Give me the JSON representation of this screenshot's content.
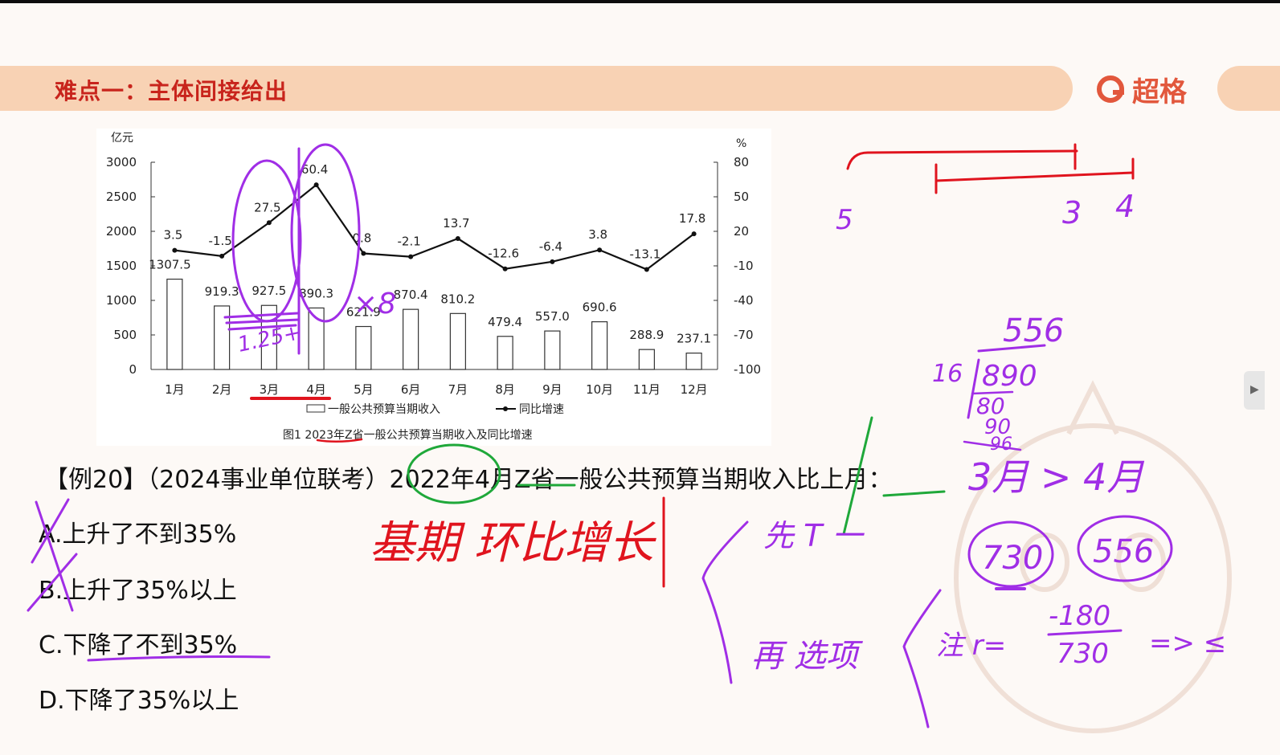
{
  "header": {
    "title": "难点一：主体间接给出",
    "brand": "超格",
    "colors": {
      "band": "#f8d2b4",
      "title": "#c8241c",
      "brand": "#e2573c"
    }
  },
  "chart_data": {
    "type": "bar",
    "left_unit": "亿元",
    "right_unit": "%",
    "categories": [
      "1月",
      "2月",
      "3月",
      "4月",
      "5月",
      "6月",
      "7月",
      "8月",
      "9月",
      "10月",
      "11月",
      "12月"
    ],
    "series": [
      {
        "name": "一般公共预算当期收入",
        "kind": "bar",
        "axis": "left",
        "values": [
          1307.5,
          919.3,
          927.5,
          890.3,
          621.9,
          870.4,
          810.2,
          479.4,
          557.0,
          690.6,
          288.9,
          237.1
        ],
        "labels": [
          "1307.5",
          "919.3",
          "927.5",
          "890.3",
          "621.9",
          "870.4",
          "810.2",
          "479.4",
          "557.0",
          "690.6",
          "288.9",
          "237.1"
        ]
      },
      {
        "name": "同比增速",
        "kind": "line",
        "axis": "right",
        "values": [
          3.5,
          -1.5,
          27.5,
          60.4,
          0.8,
          -2.1,
          13.7,
          -12.6,
          -6.4,
          3.8,
          -13.1,
          17.8
        ],
        "labels": [
          "3.5",
          "-1.5",
          "27.5",
          "60.4",
          "0.8",
          "-2.1",
          "13.7",
          "-12.6",
          "-6.4",
          "3.8",
          "-13.1",
          "17.8"
        ]
      }
    ],
    "left_axis": {
      "ylim": [
        0,
        3000
      ],
      "ticks": [
        "0",
        "500",
        "1000",
        "1500",
        "2000",
        "2500",
        "3000"
      ]
    },
    "right_axis": {
      "ylim": [
        -100,
        80
      ],
      "ticks": [
        "-100",
        "-70",
        "-40",
        "-10",
        "20",
        "50",
        "80"
      ]
    },
    "caption": "图1  2023年Z省一般公共预算当期收入及同比增速",
    "legend_position": "bottom",
    "grid": false,
    "colors": {
      "bar": "#ffffff",
      "bar_stroke": "#333333",
      "line": "#111111"
    }
  },
  "question": {
    "text": "【例20】（2024事业单位联考）2022年4月Z省一般公共预算当期收入比上月：",
    "options": [
      {
        "key": "A",
        "text": "A.上升了不到35%"
      },
      {
        "key": "B",
        "text": "B.上升了35%以上"
      },
      {
        "key": "C",
        "text": "C.下降了不到35%"
      },
      {
        "key": "D",
        "text": "D.下降了35%以上"
      }
    ]
  },
  "handwriting": {
    "chart_notes": [
      "×8",
      "1.25+"
    ],
    "timeline_labels": [
      "5",
      "3",
      "4"
    ],
    "center_note": "基期 环比增长",
    "steps": [
      "先 T 一",
      "再 选项"
    ],
    "division": {
      "quotient": "556",
      "divisor": "16",
      "dividend": "890",
      "step1": "80",
      "step2": "90",
      "step3": "96"
    },
    "compare": "3月 > 4月",
    "circled": [
      "730",
      "556"
    ],
    "formula_prefix": "注 r=",
    "numerator": "-180",
    "denominator": "730",
    "result": "=> ≤",
    "colors": {
      "purple": "#a02ee6",
      "red": "#e0141e",
      "green": "#1fa83a"
    }
  }
}
